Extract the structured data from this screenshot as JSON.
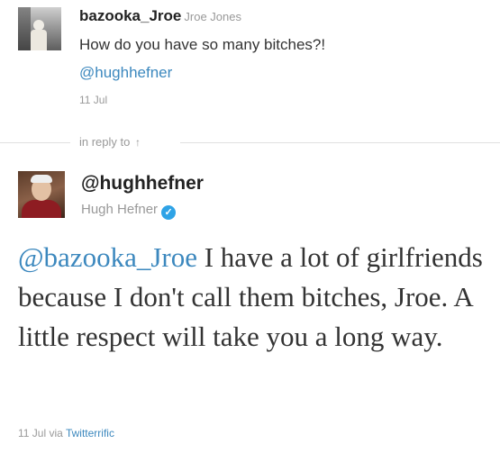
{
  "original_tweet": {
    "screen_name": "bazooka_Jroe",
    "full_name": "Jroe Jones",
    "text": "How do you have so many bitches?!",
    "mention": "@hughhefner",
    "date": "11 Jul"
  },
  "in_reply_to": {
    "label": "in reply to",
    "icon": "up-arrow-icon"
  },
  "reply_tweet": {
    "screen_name": "@hughhefner",
    "full_name": "Hugh Hefner",
    "verified_icon": "verified-badge-icon",
    "mention": "@bazooka_Jroe",
    "text": " I have a lot of girlfriends because I don't call them bitches, Jroe. A little respect will take you a long way.",
    "date": "11 Jul",
    "via_label": "via",
    "via_app": "Twitterrific"
  },
  "colors": {
    "link": "#3c88be",
    "meta_gray": "#999999",
    "verified": "#2fa3e6"
  }
}
